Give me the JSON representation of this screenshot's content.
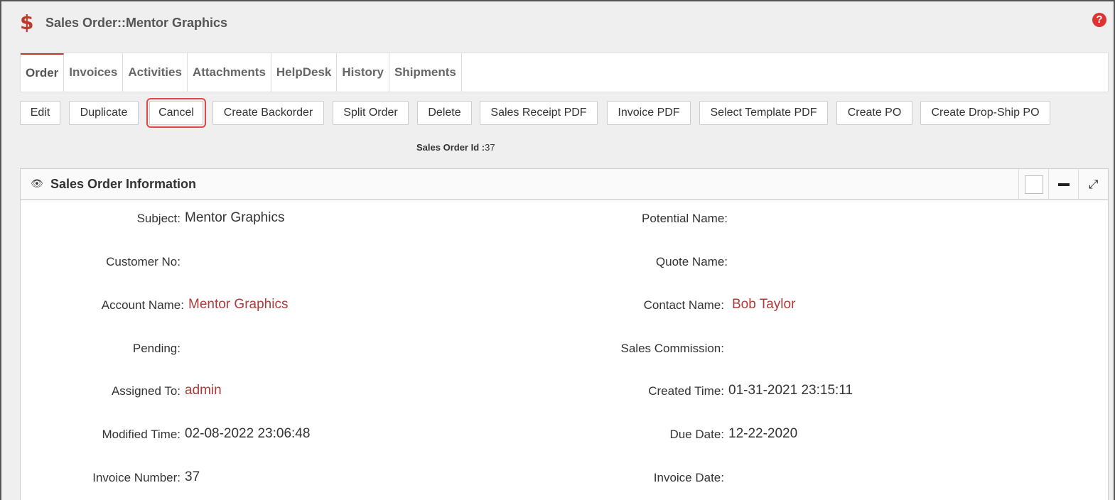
{
  "header": {
    "title": "Sales Order::Mentor Graphics",
    "icon": "dollar-icon",
    "help_icon": "help-icon"
  },
  "tabs": [
    {
      "label": "Order",
      "active": true
    },
    {
      "label": "Invoices"
    },
    {
      "label": "Activities"
    },
    {
      "label": "Attachments"
    },
    {
      "label": "HelpDesk"
    },
    {
      "label": "History"
    },
    {
      "label": "Shipments"
    }
  ],
  "toolbar": {
    "buttons": [
      {
        "label": "Edit"
      },
      {
        "label": "Duplicate"
      },
      {
        "label": "Cancel",
        "highlighted": true
      },
      {
        "label": "Create Backorder"
      },
      {
        "label": "Split Order"
      },
      {
        "label": "Delete"
      },
      {
        "label": "Sales Receipt PDF"
      },
      {
        "label": "Invoice PDF"
      },
      {
        "label": "Select Template PDF"
      },
      {
        "label": "Create PO"
      },
      {
        "label": "Create Drop-Ship PO"
      }
    ]
  },
  "sales_order_id": {
    "label": "Sales Order Id :",
    "value": "37"
  },
  "panel": {
    "title": "Sales Order Information",
    "fields": {
      "subject": {
        "label": "Subject:",
        "value": "Mentor Graphics"
      },
      "potential_name": {
        "label": "Potential Name:",
        "value": ""
      },
      "customer_no": {
        "label": "Customer No:",
        "value": ""
      },
      "quote_name": {
        "label": "Quote Name:",
        "value": ""
      },
      "account_name": {
        "label": "Account Name:",
        "value": "Mentor Graphics"
      },
      "contact_name": {
        "label": "Contact Name:",
        "value": "Bob Taylor"
      },
      "pending": {
        "label": "Pending:",
        "value": ""
      },
      "sales_commission": {
        "label": "Sales Commission:",
        "value": ""
      },
      "assigned_to": {
        "label": "Assigned To:",
        "value": "admin"
      },
      "created_time": {
        "label": "Created Time:",
        "value": "01-31-2021 23:15:11"
      },
      "modified_time": {
        "label": "Modified Time:",
        "value": "02-08-2022 23:06:48"
      },
      "due_date": {
        "label": "Due Date:",
        "value": "12-22-2020"
      },
      "invoice_number": {
        "label": "Invoice Number:",
        "value": "37"
      },
      "invoice_date": {
        "label": "Invoice Date:",
        "value": ""
      }
    }
  },
  "colors": {
    "accent": "#c0392b",
    "link": "#b03a3a",
    "highlight_outline": "#e04848"
  }
}
